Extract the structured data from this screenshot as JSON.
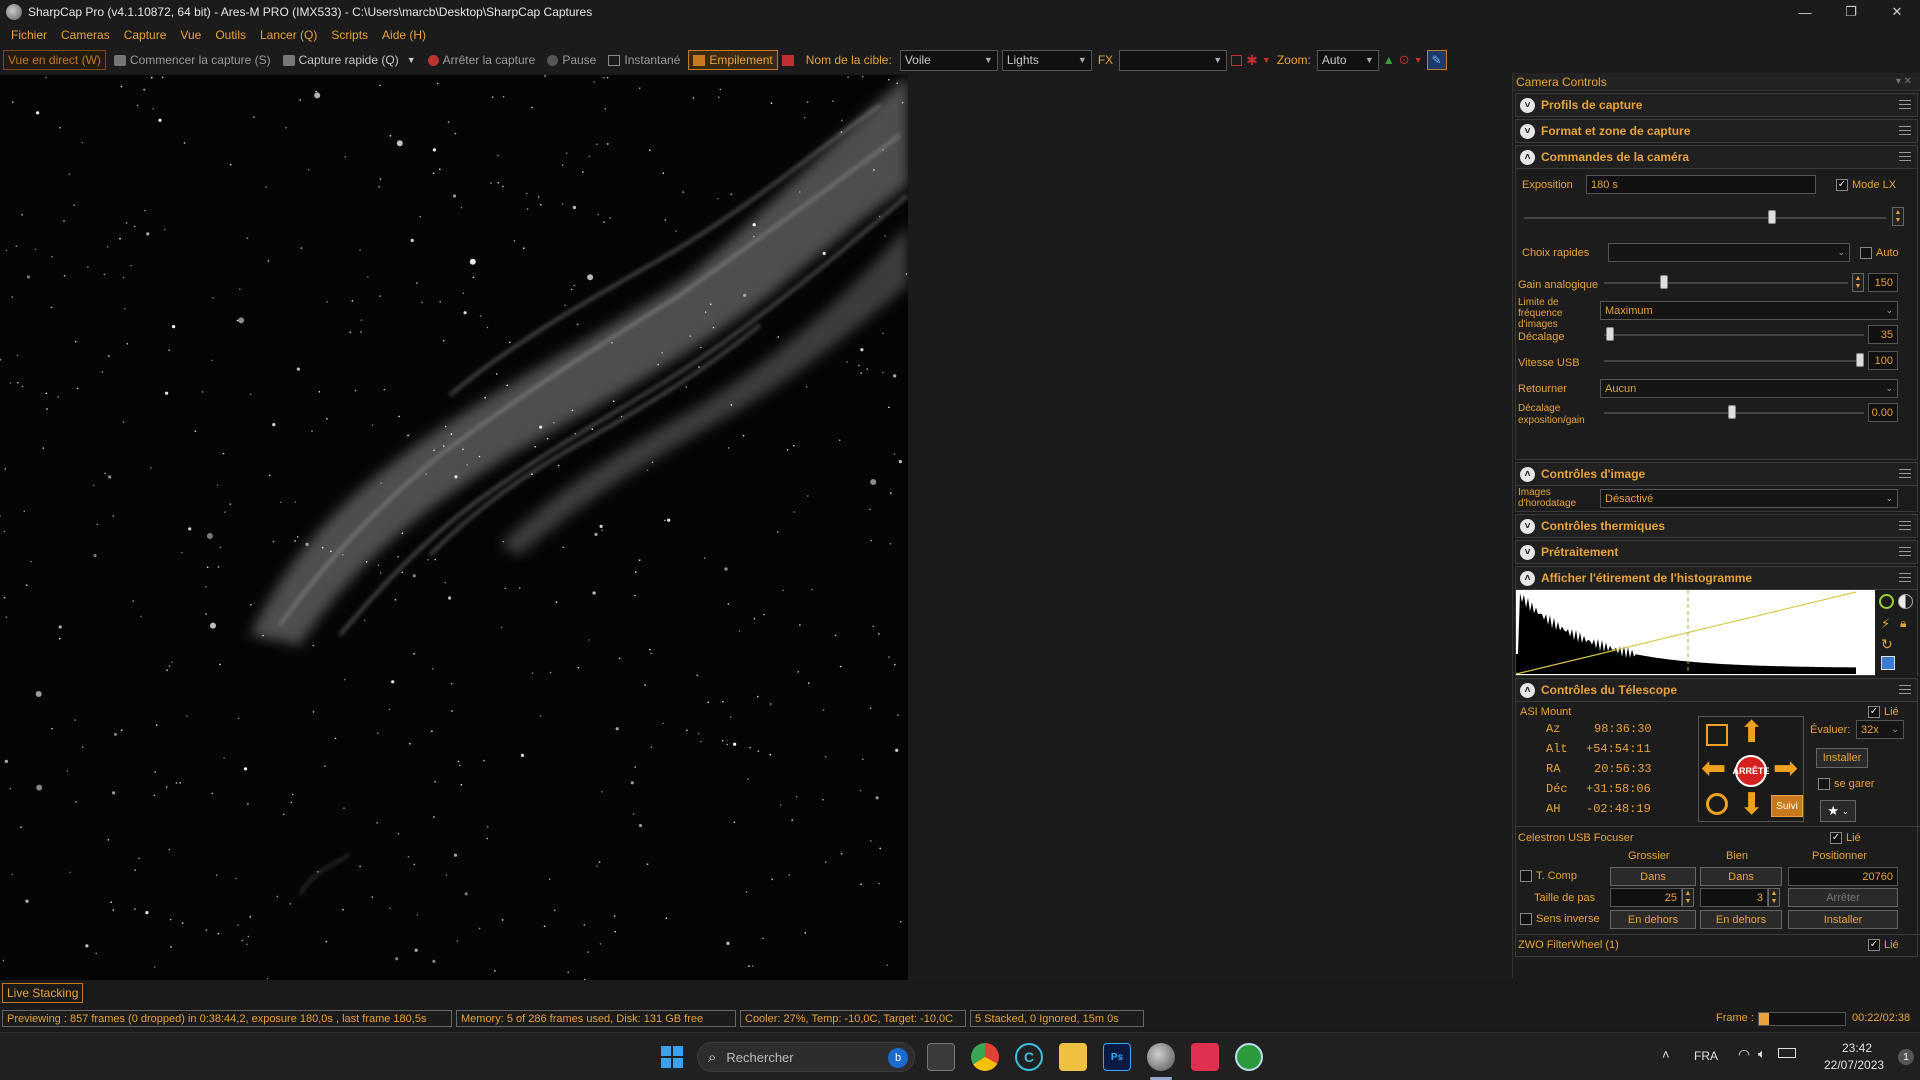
{
  "window": {
    "title": "SharpCap Pro (v4.1.10872, 64 bit) - Ares-M PRO (IMX533) - C:\\Users\\marcb\\Desktop\\SharpCap Captures",
    "minimize": "—",
    "maximize": "❐",
    "close": "✕"
  },
  "menu": [
    "Fichier",
    "Cameras",
    "Capture",
    "Vue",
    "Outils",
    "Lancer (Q)",
    "Scripts",
    "Aide (H)"
  ],
  "toolbar": {
    "live_view": "Vue en direct (W)",
    "start_capture": "Commencer la capture (S)",
    "quick_capture": "Capture rapide (Q)",
    "stop_capture": "Arrêter la capture",
    "pause": "Pause",
    "snapshot": "Instantané",
    "stacking": "Empilement",
    "target_label": "Nom de la cible:",
    "target_value": "Voile",
    "frame_type": "Lights",
    "fx_label": "FX",
    "fx_value": "",
    "zoom_label": "Zoom:",
    "zoom_value": "Auto"
  },
  "panel": {
    "title": "Camera Controls",
    "sections": {
      "capture_profiles": "Profils de capture",
      "format_area": "Format et zone de capture",
      "camera_controls": "Commandes de la caméra",
      "image_controls": "Contrôles d'image",
      "thermal_controls": "Contrôles thermiques",
      "preprocessing": "Prétraitement",
      "histogram": "Afficher l'étirement de l'histogramme",
      "telescope": "Contrôles du Télescope"
    },
    "camera": {
      "exposure_label": "Exposition",
      "exposure_value": "180 s",
      "mode_lx_label": "Mode LX",
      "quick_choices_label": "Choix rapides",
      "quick_choices_value": "",
      "auto_label": "Auto",
      "gain_label": "Gain analogique",
      "gain_value": "150",
      "frame_rate_label": "Limite de fréquence d'images",
      "frame_rate_value": "Maximum",
      "offset_label": "Décalage",
      "offset_value": "35",
      "usb_label": "Vitesse USB",
      "usb_value": "100",
      "flip_label": "Retourner",
      "flip_value": "Aucun",
      "exp_gain_label": "Décalage exposition/gain",
      "exp_gain_value": "0.00"
    },
    "image_controls": {
      "timestamp_label": "Images d'horodatage",
      "timestamp_value": "Désactivé"
    },
    "telescope": {
      "mount_name": "ASI Mount",
      "linked_label": "Lié",
      "coords": [
        {
          "label": "Az",
          "value": "98:36:30"
        },
        {
          "label": "Alt",
          "value": "+54:54:11"
        },
        {
          "label": "RA",
          "value": "20:56:33"
        },
        {
          "label": "Déc",
          "value": "+31:58:06"
        },
        {
          "label": "AH",
          "value": "-02:48:19"
        }
      ],
      "stop_label": "ARRÊTE",
      "rate_label": "Évaluer:",
      "rate_value": "32x",
      "install_label": "Installer",
      "park_label": "se garer",
      "track_label": "Suivi"
    },
    "focuser": {
      "name": "Celestron USB Focuser",
      "linked_label": "Lié",
      "col_coarse": "Grossier",
      "col_fine": "Bien",
      "col_position": "Positionner",
      "tcomp_label": "T. Comp",
      "in_label": "Dans",
      "position_value": "20760",
      "step_label": "Taille de pas",
      "coarse_step": "25",
      "fine_step": "3",
      "stop_label": "Arrêter",
      "reverse_label": "Sens inverse",
      "out_label": "En dehors",
      "install_label": "Installer"
    },
    "filterwheel": {
      "name": "ZWO FilterWheel (1)",
      "linked_label": "Lié"
    }
  },
  "live_stacking_label": "Live Stacking",
  "status": {
    "preview": "Previewing : 857 frames (0 dropped) in 0:38:44,2, exposure 180,0s , last frame 180,5s",
    "memory": "Memory: 5 of 286 frames used, Disk: 131 GB free",
    "cooler": "Cooler: 27%, Temp: -10,0C, Target: -10,0C",
    "stacked": "5 Stacked, 0 Ignored, 15m 0s",
    "frame_label": "Frame :",
    "frame_progress": 0.12,
    "time": "00:22/02:38"
  },
  "taskbar": {
    "search_placeholder": "Rechercher",
    "language": "FRA",
    "clock_time": "23:42",
    "clock_date": "22/07/2023",
    "notification_count": "1",
    "apps": [
      "start-icon",
      "task-view-icon",
      "chrome-icon",
      "ccleaner-icon",
      "file-explorer-icon",
      "photoshop-icon",
      "sharpcap-icon",
      "app-red-icon",
      "app-green-icon"
    ]
  },
  "colors": {
    "accent": "#e8a23b",
    "background": "#1b1b1b",
    "stop_red": "#d62020"
  }
}
